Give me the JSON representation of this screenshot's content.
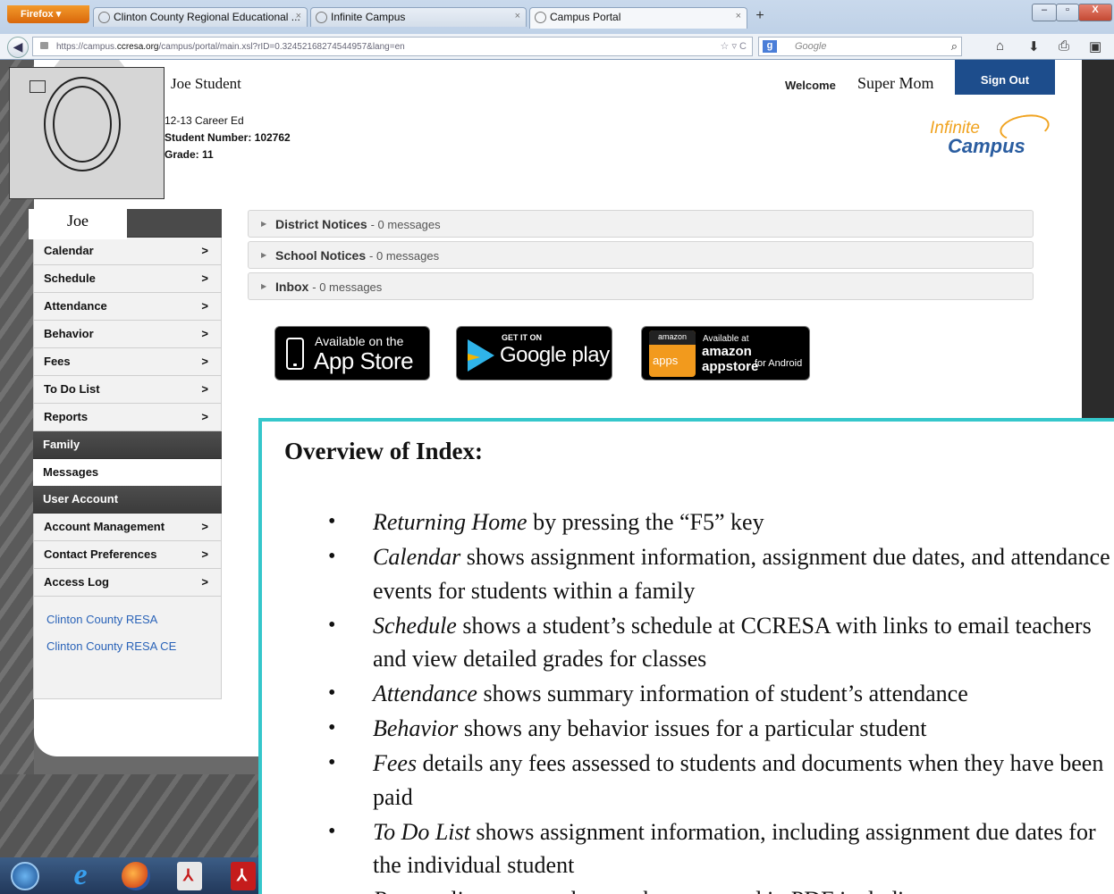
{
  "browser": {
    "firefox_label": "Firefox",
    "tabs": [
      {
        "label": "Clinton County Regional Educational ...",
        "close": "×"
      },
      {
        "label": "Infinite Campus",
        "close": "×"
      },
      {
        "label": "Campus Portal",
        "close": "×"
      }
    ],
    "new_tab": "+",
    "url_prefix": "https://campus.",
    "url_host": "ccresa.org",
    "url_rest": "/campus/portal/main.xsl?rID=0.32452168274544957&lang=en",
    "url_tools": "☆ ▿ C",
    "search_placeholder": "Google",
    "window_controls": [
      "–",
      "▫",
      "X"
    ]
  },
  "header": {
    "student_name": "Joe Student",
    "program": "12-13 Career Ed",
    "student_number": "Student Number: 102762",
    "grade": "Grade: 11",
    "welcome": "Welcome",
    "user_name": "Super Mom",
    "sign_out": "Sign Out",
    "logo_line1": "Infinite",
    "logo_line2": "Campus"
  },
  "sidebar": {
    "name": "Joe",
    "items": [
      {
        "label": "Calendar",
        "chevron": ">"
      },
      {
        "label": "Schedule",
        "chevron": ">"
      },
      {
        "label": "Attendance",
        "chevron": ">"
      },
      {
        "label": "Behavior",
        "chevron": ">"
      },
      {
        "label": "Fees",
        "chevron": ">"
      },
      {
        "label": "To Do List",
        "chevron": ">"
      },
      {
        "label": "Reports",
        "chevron": ">"
      }
    ],
    "family_section": "Family",
    "messages": "Messages",
    "user_account_section": "User Account",
    "account_items": [
      {
        "label": "Account Management",
        "chevron": ">"
      },
      {
        "label": "Contact Preferences",
        "chevron": ">"
      },
      {
        "label": "Access Log",
        "chevron": ">"
      }
    ],
    "links": [
      "Clinton County RESA",
      "Clinton County RESA CE"
    ]
  },
  "notices": [
    {
      "title": "District Notices",
      "count": "0 messages"
    },
    {
      "title": "School Notices",
      "count": "0 messages"
    },
    {
      "title": "Inbox",
      "count": "0 messages"
    }
  ],
  "badges": {
    "appstore_small": "Available on the",
    "appstore_big": "App Store",
    "googleplay_small": "GET IT ON",
    "googleplay_big": "Google play",
    "amazon_top": "amazon",
    "amazon_apps": "apps",
    "amazon_small": "Available at",
    "amazon_big": "amazon appstore",
    "amazon_for": "for Android"
  },
  "overview": {
    "title": "Overview of Index:",
    "items": [
      {
        "term": "Returning Home",
        "text": " by pressing the “F5” key"
      },
      {
        "term": "Calendar",
        "text": " shows assignment information, assignment due dates, and attendance events for students within a family"
      },
      {
        "term": "Schedule",
        "text": " shows a student’s schedule at CCRESA with links to email teachers and view detailed grades for classes"
      },
      {
        "term": "Attendance",
        "text": " shows summary information of student’s attendance"
      },
      {
        "term": "Behavior",
        "text": " shows any behavior issues for a particular student"
      },
      {
        "term": "Fees",
        "text": " details any fees assessed to students and documents when they have been paid"
      },
      {
        "term": "To Do List",
        "text": " shows assignment information, including assignment due dates for the individual student"
      },
      {
        "term": "Reports",
        "text": " lists reports that can be generated in PDF including"
      }
    ]
  }
}
